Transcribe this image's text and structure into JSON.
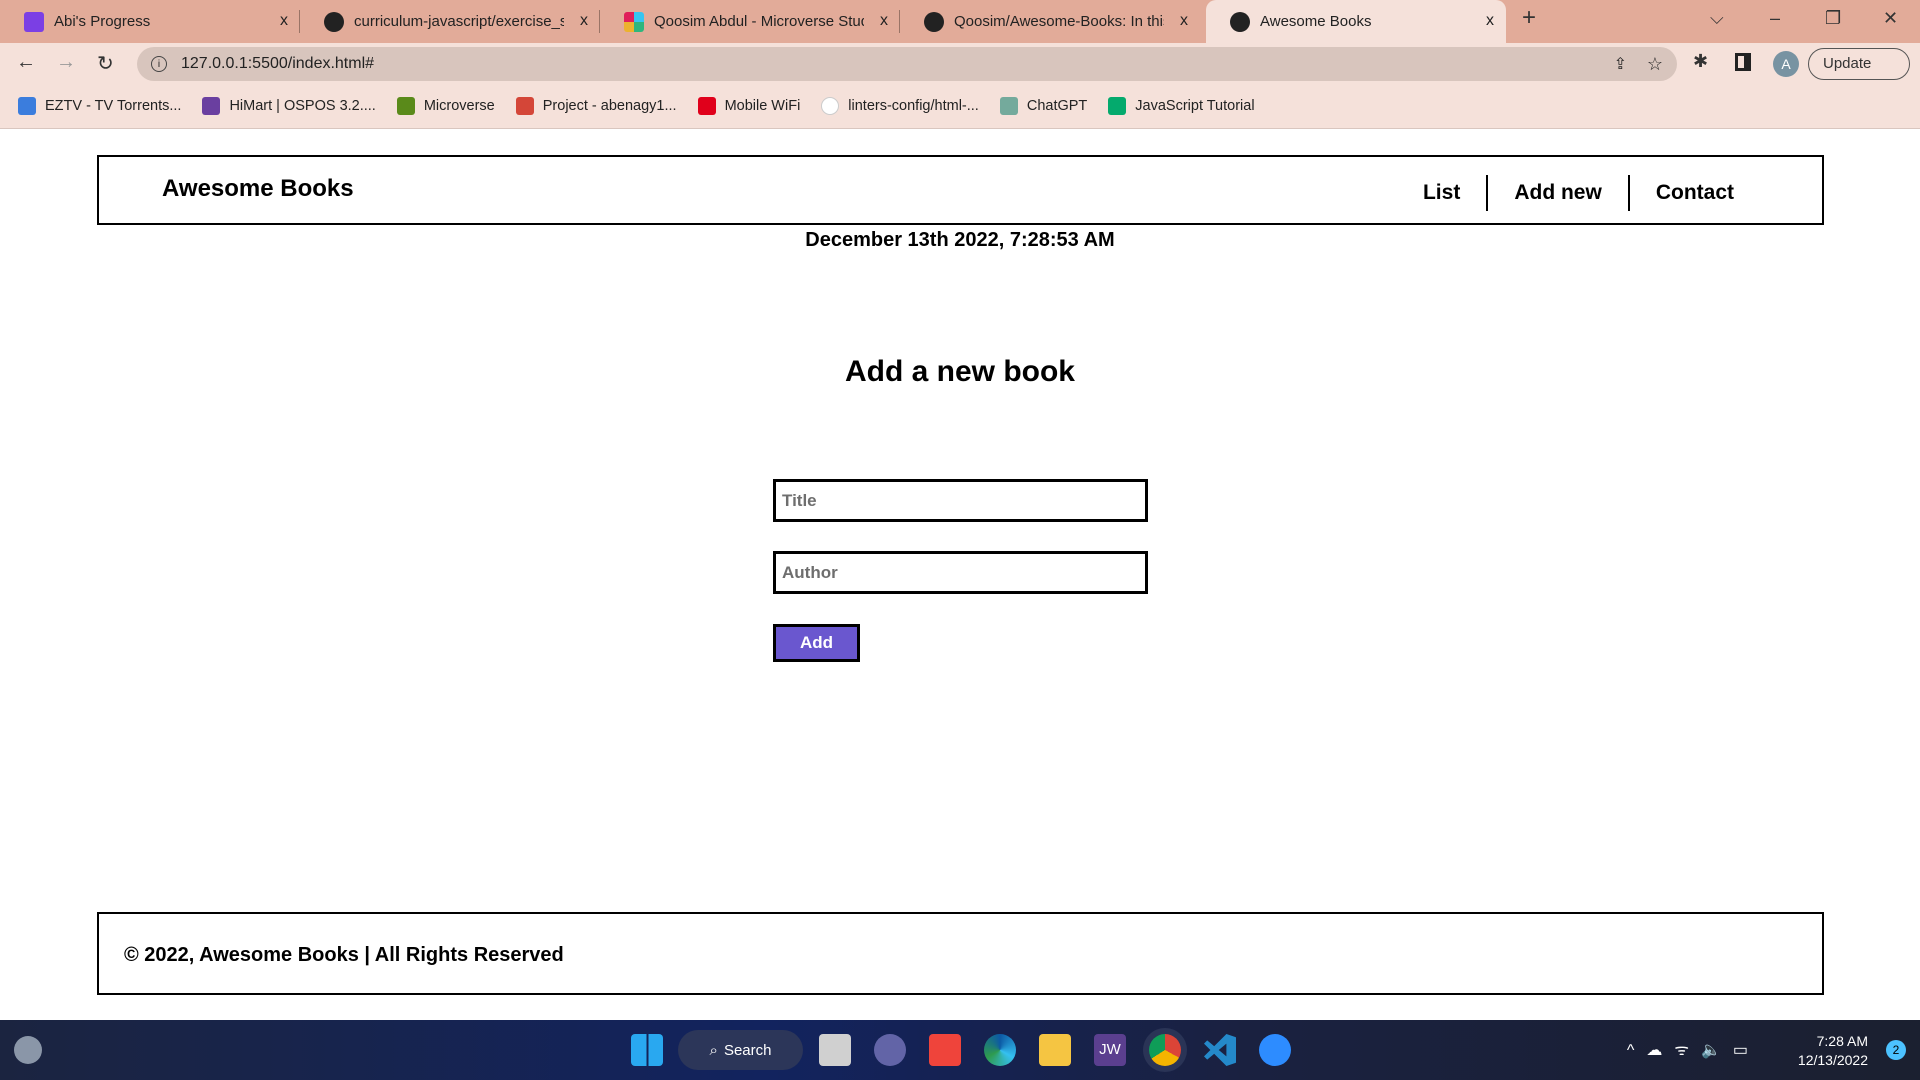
{
  "browser": {
    "tabs": [
      {
        "label": "Abi's Progress",
        "icon": "app-icon",
        "color": "#7b3fe4"
      },
      {
        "label": "curriculum-javascript/exercise_se",
        "icon": "github-icon",
        "color": "#222222"
      },
      {
        "label": "Qoosim Abdul - Microverse Stud",
        "icon": "slack-icon",
        "color": "#e01e5a"
      },
      {
        "label": "Qoosim/Awesome-Books: In this",
        "icon": "github-icon",
        "color": "#222222"
      },
      {
        "label": "Awesome Books",
        "icon": "globe-icon",
        "color": "#222222",
        "active": true
      }
    ],
    "close_glyph": "x",
    "new_tab_glyph": "+",
    "url": "127.0.0.1:5500/index.html#",
    "profile_initial": "A",
    "update_label": "Update",
    "bookmarks": [
      {
        "label": "EZTV - TV Torrents...",
        "color": "#3b7ddd"
      },
      {
        "label": "HiMart | OSPOS 3.2....",
        "color": "#6a3fa0"
      },
      {
        "label": "Microverse",
        "color": "#5a8a1a"
      },
      {
        "label": "Project - abenagy1...",
        "color": "#d44638"
      },
      {
        "label": "Mobile WiFi",
        "color": "#e0001b"
      },
      {
        "label": "linters-config/html-...",
        "color": "#ffffff"
      },
      {
        "label": "ChatGPT",
        "color": "#74aa9c"
      },
      {
        "label": "JavaScript Tutorial",
        "color": "#04aa6d"
      }
    ]
  },
  "page": {
    "logo": "Awesome Books",
    "nav": [
      "List",
      "Add new",
      "Contact"
    ],
    "date": "December 13th 2022, 7:28:53 AM",
    "heading": "Add a new book",
    "title_placeholder": "Title",
    "author_placeholder": "Author",
    "add_label": "Add",
    "accent": "#6a57cf",
    "footer": "© 2022, Awesome Books | All Rights Reserved"
  },
  "taskbar": {
    "search_label": "Search",
    "apps": [
      "windows-start",
      "file-explorer-stack",
      "teams",
      "anydesk",
      "edge",
      "file-explorer",
      "jw",
      "chrome",
      "vscode",
      "zoom"
    ],
    "time": "7:28 AM",
    "date": "12/13/2022",
    "notifications": "2"
  }
}
